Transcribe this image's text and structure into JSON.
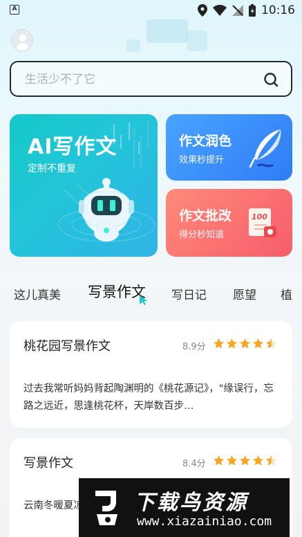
{
  "status_bar": {
    "time": "10:16",
    "left_icon_letter": "A"
  },
  "search": {
    "placeholder": "生活少不了它"
  },
  "cards": {
    "main": {
      "title": "AI写作文",
      "subtitle": "定制不重复"
    },
    "polish": {
      "title": "作文润色",
      "subtitle": "效果秒提升"
    },
    "review": {
      "title": "作文批改",
      "subtitle": "得分秒知道",
      "stamp_text": "100"
    }
  },
  "tabs": [
    {
      "label": "这儿真美",
      "active": false
    },
    {
      "label": "写景作文",
      "active": true
    },
    {
      "label": "写日记",
      "active": false
    },
    {
      "label": "愿望",
      "active": false
    },
    {
      "label": "植",
      "active": false
    }
  ],
  "essays": [
    {
      "title": "桃花园写景作文",
      "score": "8.9分",
      "rating": 4.5,
      "excerpt": "过去我常听妈妈背起陶渊明的《桃花源记》，\"缘误行，忘路之远近，思逢桃花杯，天岸数百步…"
    },
    {
      "title": "写景作文",
      "score": "8.4分",
      "rating": 4.5,
      "excerpt": "云南冬暖夏凉，我趁这个寒假去了云南游玩"
    }
  ],
  "watermark": {
    "title": "下载鸟资源",
    "url": "www.xiazainiao.com"
  },
  "colors": {
    "accent_teal": "#1cc6c9",
    "polish_blue": "#3b8ffb",
    "review_red": "#f96a6f",
    "star": "#f6a623"
  }
}
